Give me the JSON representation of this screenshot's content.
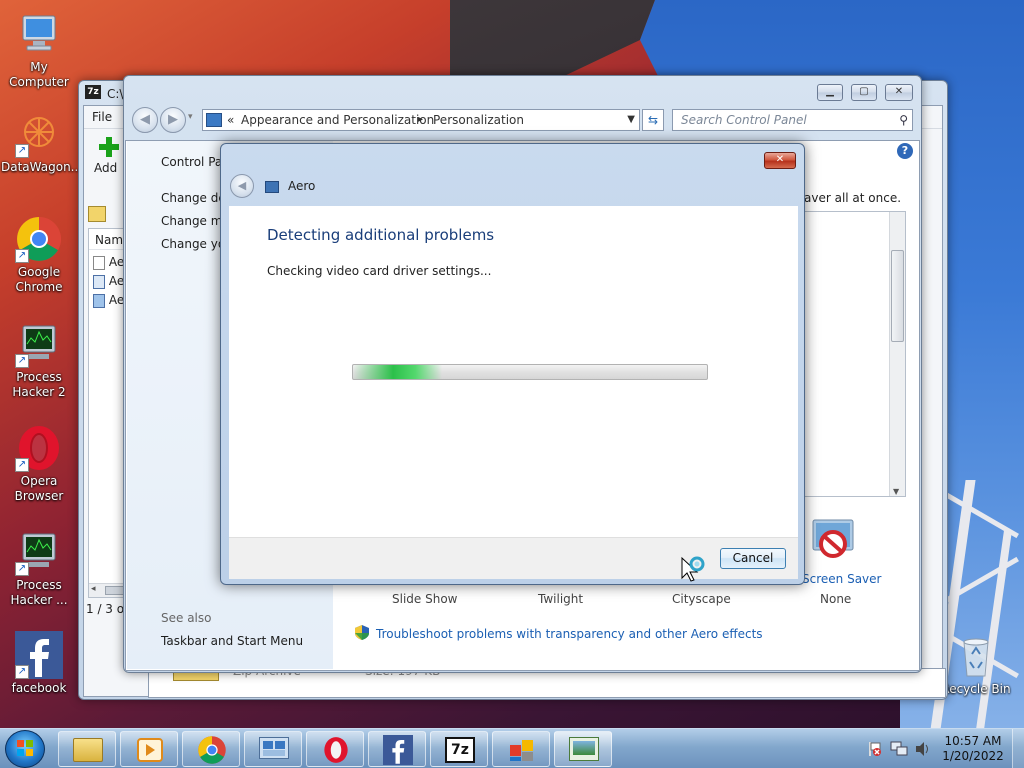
{
  "desktop_icons": [
    {
      "label": "My Computer",
      "icon": "computer-icon"
    },
    {
      "label": "DataWagon...",
      "icon": "datawagon-icon"
    },
    {
      "label": "Google Chrome",
      "icon": "chrome-icon"
    },
    {
      "label": "Process Hacker 2",
      "icon": "process-hacker-icon"
    },
    {
      "label": "Opera Browser",
      "icon": "opera-icon"
    },
    {
      "label": "Process Hacker ...",
      "icon": "process-hacker-icon"
    },
    {
      "label": "facebook",
      "icon": "facebook-icon"
    },
    {
      "label": "Recycle Bin",
      "icon": "recycle-bin-icon"
    }
  ],
  "window_7z": {
    "title": "C:\\",
    "menu_file": "File",
    "toolbar_add": "Add",
    "column_name": "Name",
    "items": [
      "Ae",
      "Ae",
      "Ae"
    ],
    "status": "1 / 3 ob",
    "bottom_row": {
      "type": "Zip Archive",
      "size": "Size: 197 KB"
    }
  },
  "control_panel": {
    "breadcrumb_prefix": "«",
    "breadcrumb_1": "Appearance and Personalization",
    "breadcrumb_sep": "▸",
    "breadcrumb_2": "Personalization",
    "search_placeholder": "Search Control Panel",
    "left_links": [
      "Control Pan",
      "Change des",
      "Change mo",
      "Change you"
    ],
    "see_also": "See also",
    "taskbar_link": "Taskbar and Start Menu",
    "right_text": "aver all at once.",
    "themes": [
      "Slide Show",
      "Twilight",
      "Cityscape"
    ],
    "screen_saver_label": "Screen Saver",
    "screen_saver_value": "None",
    "troubleshoot_link": "Troubleshoot problems with transparency and other Aero effects"
  },
  "dialog": {
    "title": "Aero",
    "heading": "Detecting additional problems",
    "status": "Checking video card driver settings...",
    "progress_fraction": 0.25,
    "cancel": "Cancel"
  },
  "taskbar": {
    "time": "10:57 AM",
    "date": "1/20/2022",
    "apps": [
      "explorer-icon",
      "media-player-icon",
      "chrome-icon",
      "remote-desktop-icon",
      "opera-icon",
      "facebook-icon",
      "7zip-icon",
      "windows-flag-icon",
      "personalization-icon"
    ],
    "seven_zip_label": "7z"
  },
  "colors": {
    "accent_link": "#1b5fb3",
    "heading_blue": "#1a3e7a",
    "progress_green": "#2cc04a"
  }
}
